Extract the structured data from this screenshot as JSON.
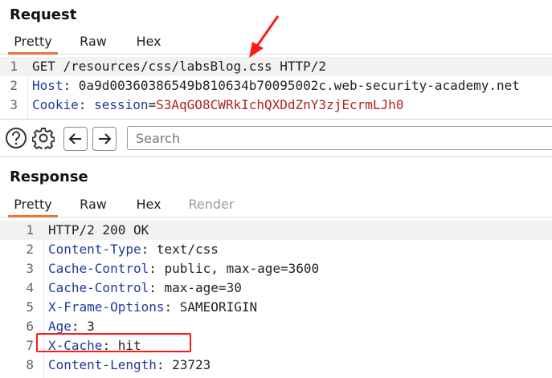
{
  "request": {
    "title": "Request",
    "tabs": [
      {
        "label": "Pretty",
        "active": true
      },
      {
        "label": "Raw",
        "active": false
      },
      {
        "label": "Hex",
        "active": false
      }
    ],
    "lines": [
      {
        "num": "1",
        "key": "",
        "text": "GET /resources/css/labsBlog.css HTTP/2"
      },
      {
        "num": "2",
        "key": "Host",
        "text": ": 0a9d00360386549b810634b70095002c.web-security-academy.net"
      },
      {
        "num": "3",
        "key": "Cookie",
        "sep": ": ",
        "attr": "session",
        "eq": "=",
        "value": "S3AqGO8CWRkIchQXDdZnY3zjEcrmLJh0"
      }
    ]
  },
  "toolbar": {
    "help_icon": "question-circle-icon",
    "settings_icon": "gear-icon",
    "back_icon": "arrow-left-icon",
    "forward_icon": "arrow-right-icon",
    "search_placeholder": "Search"
  },
  "response": {
    "title": "Response",
    "tabs": [
      {
        "label": "Pretty",
        "active": true
      },
      {
        "label": "Raw",
        "active": false
      },
      {
        "label": "Hex",
        "active": false
      },
      {
        "label": "Render",
        "active": false,
        "disabled": true
      }
    ],
    "lines": [
      {
        "num": "1",
        "key": "",
        "text": "HTTP/2 200 OK"
      },
      {
        "num": "2",
        "key": "Content-Type",
        "text": ": text/css"
      },
      {
        "num": "3",
        "key": "Cache-Control",
        "text": ": public, max-age=3600"
      },
      {
        "num": "4",
        "key": "Cache-Control",
        "text": ": max-age=30"
      },
      {
        "num": "5",
        "key": "X-Frame-Options",
        "text": ": SAMEORIGIN"
      },
      {
        "num": "6",
        "key": "Age",
        "text": ": 3"
      },
      {
        "num": "7",
        "key": "X-Cache",
        "text": ": hit"
      },
      {
        "num": "8",
        "key": "Content-Length",
        "text": ": 23723"
      }
    ]
  },
  "annotation_colors": {
    "arrow": "#ff1a1a",
    "box": "#ff1a1a",
    "tab_accent": "#e8743b",
    "header_key": "#1f3b9a",
    "cookie_value": "#b22222"
  }
}
